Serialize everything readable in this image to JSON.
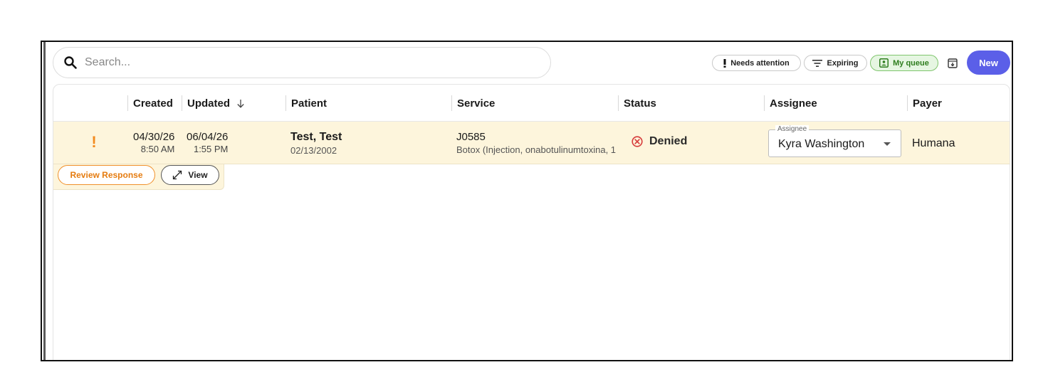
{
  "search": {
    "placeholder": "Search..."
  },
  "filters": {
    "needs_attention": "Needs attention",
    "expiring": "Expiring",
    "my_queue": "My queue"
  },
  "toolbar": {
    "new_label": "New"
  },
  "table": {
    "columns": {
      "created": "Created",
      "updated": "Updated",
      "updated_sort_icon": "arrow-down-icon",
      "patient": "Patient",
      "service": "Service",
      "status": "Status",
      "assignee": "Assignee",
      "payer": "Payer"
    },
    "rows": [
      {
        "created_date": "04/30/26",
        "created_time": "8:50 AM",
        "updated_date": "06/04/26",
        "updated_time": "1:55 PM",
        "patient_name": "Test, Test",
        "patient_dob": "02/13/2002",
        "service_code": "J0585",
        "service_desc": "Botox (Injection, onabotulinumtoxina, 1",
        "status": "Denied",
        "assignee_label": "Assignee",
        "assignee": "Kyra Washington",
        "payer": "Humana",
        "attention_flag": "!",
        "actions": {
          "review": "Review Response",
          "view": "View"
        }
      }
    ]
  },
  "colors": {
    "accent": "#5b5fe8",
    "row_highlight": "#fdf5dc",
    "attention": "#f28a1e",
    "denied": "#d63b3b",
    "queue_active": "#2e7d1e"
  }
}
